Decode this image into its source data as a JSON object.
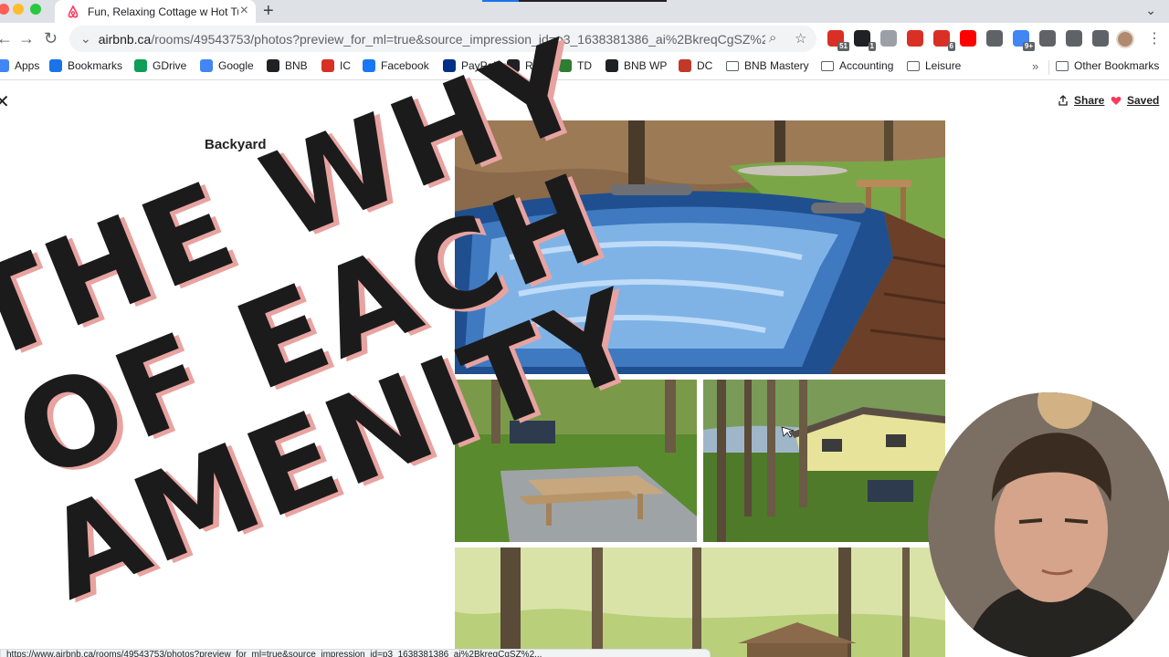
{
  "browser": {
    "tab": {
      "title": "Fun, Relaxing Cottage w Hot Tu",
      "favicon": "airbnb-icon"
    },
    "new_tab_label": "+",
    "url": {
      "host": "airbnb.ca",
      "path": "/rooms/49543753/photos?preview_for_ml=true&source_impression_id=p3_1638381386_ai%2BkreqCgSZ%2..."
    },
    "extensions": [
      {
        "name": "apple-icon",
        "color": "#d93025",
        "badge": "51"
      },
      {
        "name": "todo-icon",
        "color": "#202124",
        "badge": "1"
      },
      {
        "name": "code-icon",
        "color": "#9aa0a6",
        "badge": ""
      },
      {
        "name": "clipper-icon",
        "color": "#d93025",
        "badge": ""
      },
      {
        "name": "calendar-icon",
        "color": "#d93025",
        "badge": "6"
      },
      {
        "name": "youtube-icon",
        "color": "#ff0000",
        "badge": ""
      },
      {
        "name": "power-icon",
        "color": "#5f6368",
        "badge": ""
      },
      {
        "name": "gear-ext-icon",
        "color": "#4285f4",
        "badge": "9+"
      },
      {
        "name": "puzzle-icon",
        "color": "#5f6368",
        "badge": ""
      },
      {
        "name": "flask-icon",
        "color": "#5f6368",
        "badge": ""
      },
      {
        "name": "reading-list-icon",
        "color": "#5f6368",
        "badge": ""
      }
    ]
  },
  "bookmarks": [
    {
      "label": "Apps",
      "icon": "apps-grid-icon",
      "color": "#4285f4"
    },
    {
      "label": "Bookmarks",
      "icon": "star-icon",
      "color": "#1a73e8"
    },
    {
      "label": "GDrive",
      "icon": "drive-icon",
      "color": "#0f9d58"
    },
    {
      "label": "Google",
      "icon": "google-icon",
      "color": "#4285f4"
    },
    {
      "label": "BNB",
      "icon": "bnb-icon",
      "color": "#202124"
    },
    {
      "label": "IC",
      "icon": "sk-icon",
      "color": "#d93025"
    },
    {
      "label": "Facebook",
      "icon": "facebook-icon",
      "color": "#1877f2"
    },
    {
      "label": "PayPal",
      "icon": "paypal-icon",
      "color": "#003087"
    },
    {
      "label": "RBC",
      "icon": "rbc-icon",
      "color": "#202124"
    },
    {
      "label": "TD",
      "icon": "td-icon",
      "color": "#2e7d32"
    },
    {
      "label": "BNB WP",
      "icon": "bnb-wp-icon",
      "color": "#202124"
    },
    {
      "label": "DC",
      "icon": "dc-icon",
      "color": "#c0392b"
    },
    {
      "label": "BNB Mastery",
      "icon": "folder-icon",
      "color": "#5f6368"
    },
    {
      "label": "Accounting",
      "icon": "folder-icon",
      "color": "#5f6368"
    },
    {
      "label": "Leisure",
      "icon": "folder-icon",
      "color": "#5f6368"
    }
  ],
  "bookmarks_more": "»",
  "other_bookmarks": "Other Bookmarks",
  "page": {
    "share_label": "Share",
    "saved_label": "Saved",
    "section_title": "Backyard",
    "accent": "#ff385c"
  },
  "overlay": {
    "lines": [
      "THE WHY",
      "OF EACH",
      "AMENITY"
    ],
    "fill": "#1c1b1c",
    "shadow": "#e8a3a0"
  },
  "status_text": "https://www.airbnb.ca/rooms/49543753/photos?preview_for_ml=true&source_impression_id=p3_1638381386_ai%2BkreqCgSZ%2..."
}
